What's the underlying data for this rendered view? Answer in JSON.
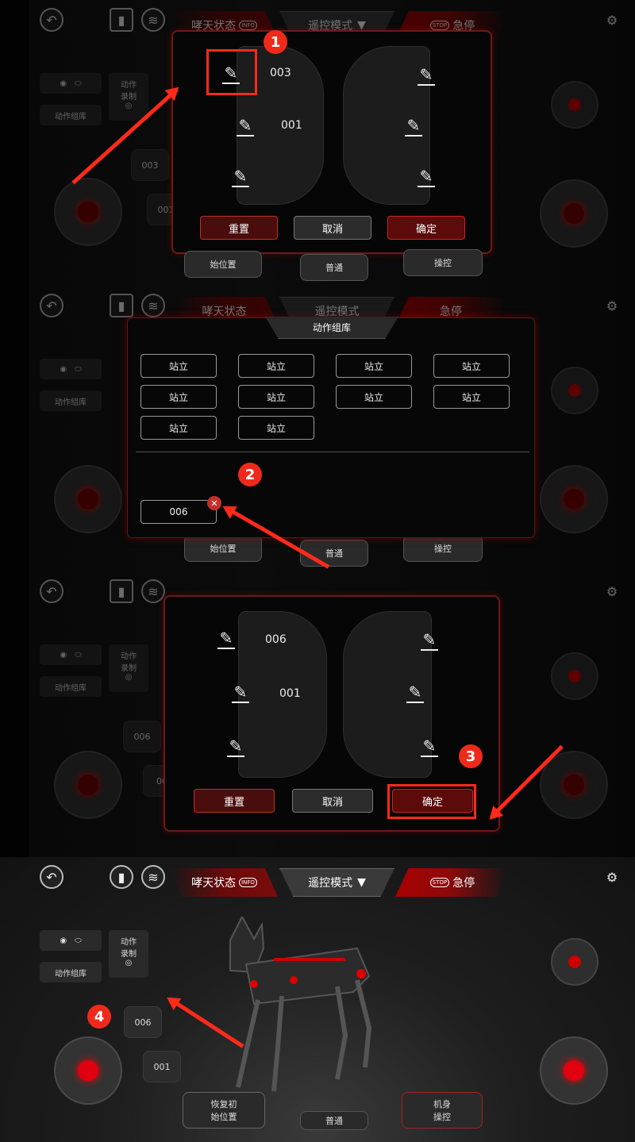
{
  "topbar": {
    "status_tab": "哮天状态",
    "status_badge": "INFO",
    "mode_tab": "遥控模式",
    "stop_tab": "急停",
    "stop_badge": "STOP"
  },
  "left": {
    "library_button": "动作组库",
    "record_label_line1": "动作",
    "record_label_line2": "录制"
  },
  "bottom": {
    "restore_line1": "恢复初",
    "restore_line2": "始位置",
    "normal": "普通",
    "body_line1": "机身",
    "body_line2": "操控"
  },
  "step1": {
    "slots": [
      "003",
      "001"
    ],
    "buttons": {
      "reset": "重置",
      "cancel": "取消",
      "confirm": "确定"
    },
    "callout": "1",
    "bg_slots": [
      "003",
      "001"
    ]
  },
  "step2": {
    "title": "动作组库",
    "actions": [
      "站立",
      "站立",
      "站立",
      "站立",
      "站立",
      "站立",
      "站立",
      "站立",
      "站立",
      "站立"
    ],
    "selected": "006",
    "callout": "2"
  },
  "step3": {
    "slots": [
      "006",
      "001"
    ],
    "buttons": {
      "reset": "重置",
      "cancel": "取消",
      "confirm": "确定"
    },
    "callout": "3",
    "bg_slots": [
      "006",
      "00"
    ]
  },
  "step4": {
    "slots": [
      "006",
      "001"
    ],
    "callout": "4"
  },
  "colors": {
    "accent": "#ff2a1a",
    "joystick": "#e00010",
    "dialog_border": "#6a1a1a"
  },
  "icons": [
    "back-icon",
    "battery-icon",
    "wifi-icon",
    "settings-icon",
    "pencil-icon",
    "close-icon",
    "camera-icon",
    "toggle-icon",
    "record-icon",
    "dropdown-icon"
  ]
}
